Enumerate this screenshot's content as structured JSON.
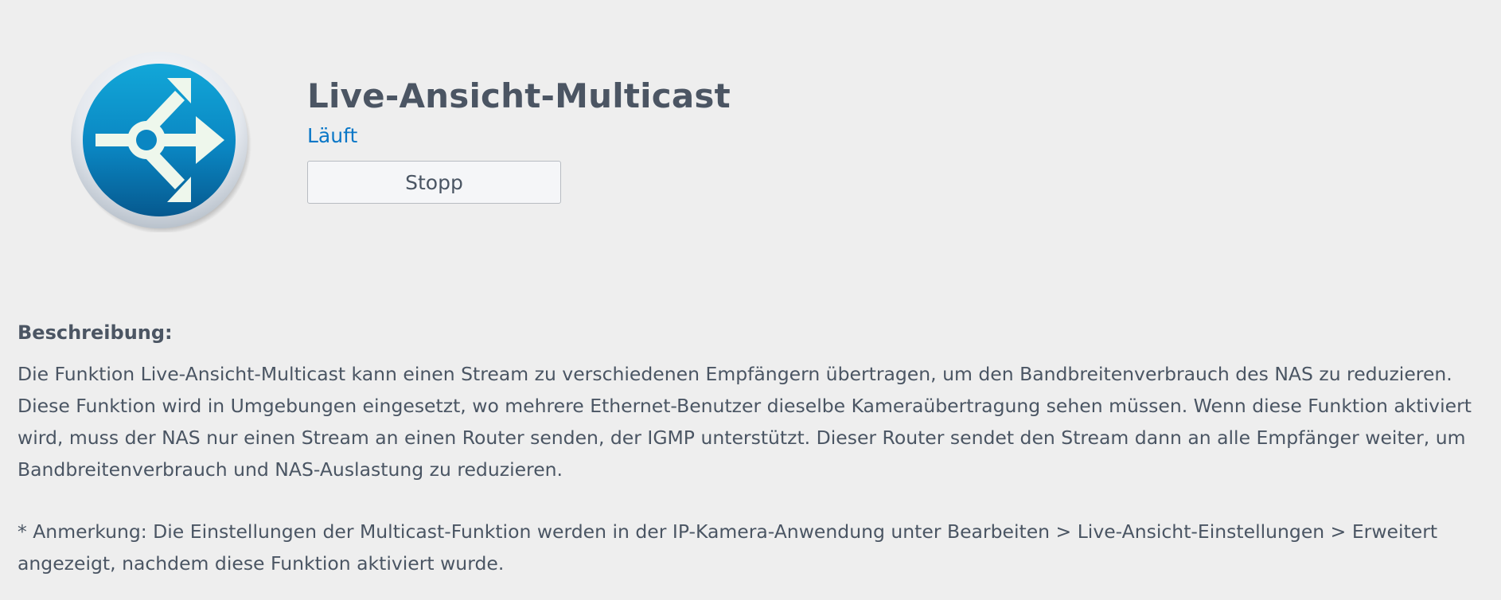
{
  "app": {
    "title": "Live-Ansicht-Multicast",
    "status": "Läuft",
    "stop_label": "Stopp",
    "icon": "multicast-arrows-icon",
    "status_color": "#0a77c7",
    "icon_color": "#0a86c2"
  },
  "description": {
    "heading": "Beschreibung:",
    "text": "Die Funktion Live-Ansicht-Multicast kann einen Stream zu verschiedenen Empfängern übertragen, um den Bandbreitenverbrauch des NAS zu reduzieren. Diese Funktion wird in Umgebungen eingesetzt, wo mehrere Ethernet-Benutzer dieselbe Kameraübertragung sehen müssen. Wenn diese Funktion aktiviert wird, muss der NAS nur einen Stream an einen Router senden, der IGMP unterstützt. Dieser Router sendet den Stream dann an alle Empfänger weiter, um Bandbreitenverbrauch und NAS-Auslastung zu reduzieren.",
    "note": "* Anmerkung: Die Einstellungen der Multicast-Funktion werden in der IP-Kamera-Anwendung unter Bearbeiten > Live-Ansicht-Einstellungen > Erweitert angezeigt, nachdem diese Funktion aktiviert wurde."
  }
}
